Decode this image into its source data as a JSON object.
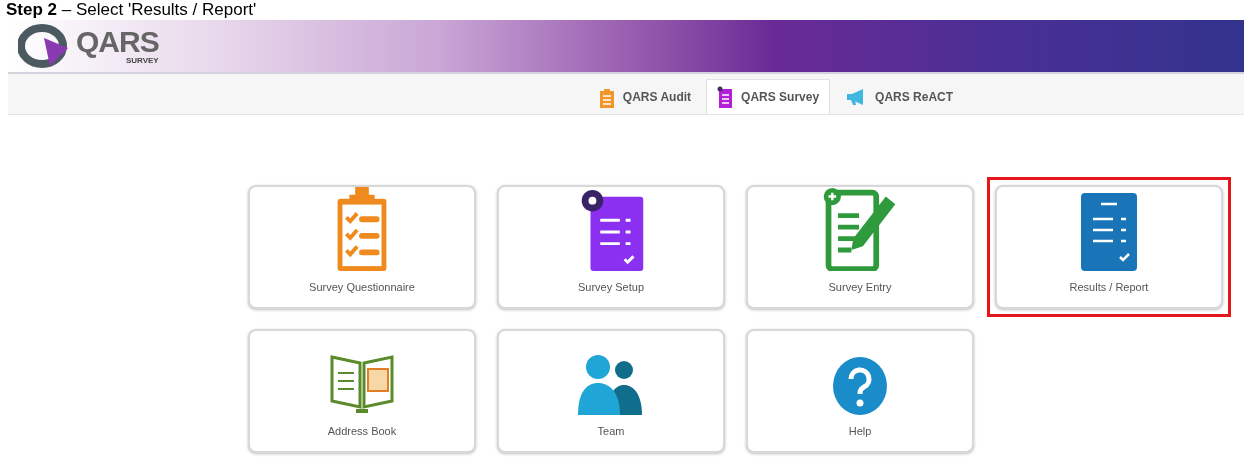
{
  "heading": "**Step 2** – Select 'Results / Report'",
  "logo": {
    "name": "QARS",
    "subtitle": "SURVEY"
  },
  "tabs": [
    {
      "label": "QARS Audit",
      "selected": false
    },
    {
      "label": "QARS Survey",
      "selected": true
    },
    {
      "label": "QARS ReACT",
      "selected": false
    }
  ],
  "tiles": [
    {
      "label": "Survey Questionnaire",
      "selected": false
    },
    {
      "label": "Survey Setup",
      "selected": false
    },
    {
      "label": "Survey Entry",
      "selected": false
    },
    {
      "label": "Results / Report",
      "selected": true
    },
    {
      "label": "Address Book",
      "selected": false
    },
    {
      "label": "Team",
      "selected": false
    },
    {
      "label": "Help",
      "selected": false
    }
  ]
}
